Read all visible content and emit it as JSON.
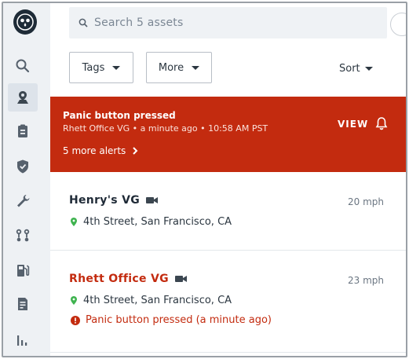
{
  "colors": {
    "alert_red": "#c32b0f",
    "sidebar_bg": "#eef1f4",
    "pin_green": "#3fb34f",
    "text_dark": "#1f2a37"
  },
  "sidebar": {
    "logo_icon": "owl-logo-icon",
    "items": [
      {
        "icon": "search-icon",
        "active": false
      },
      {
        "icon": "map-pin-icon",
        "active": true
      },
      {
        "icon": "clipboard-icon",
        "active": false
      },
      {
        "icon": "shield-check-icon",
        "active": false
      },
      {
        "icon": "wrench-icon",
        "active": false
      },
      {
        "icon": "route-icon",
        "active": false
      },
      {
        "icon": "fuel-icon",
        "active": false
      },
      {
        "icon": "document-icon",
        "active": false
      },
      {
        "icon": "bar-chart-icon",
        "active": false
      }
    ]
  },
  "search": {
    "placeholder": "Search 5 assets"
  },
  "filters": {
    "tags_label": "Tags",
    "more_label": "More",
    "sort_label": "Sort"
  },
  "alert": {
    "title": "Panic button pressed",
    "subtitle": "Rhett Office VG • a minute ago • 10:58 AM PST",
    "more_alerts": "5 more alerts",
    "view_label": "VIEW"
  },
  "assets": [
    {
      "name": "Henry's VG",
      "speed": "20 mph",
      "location": "4th Street, San Francisco, CA",
      "warning": ""
    },
    {
      "name": "Rhett Office VG",
      "speed": "23 mph",
      "location": "4th Street, San Francisco, CA",
      "warning": "Panic button pressed (a minute ago)"
    }
  ]
}
